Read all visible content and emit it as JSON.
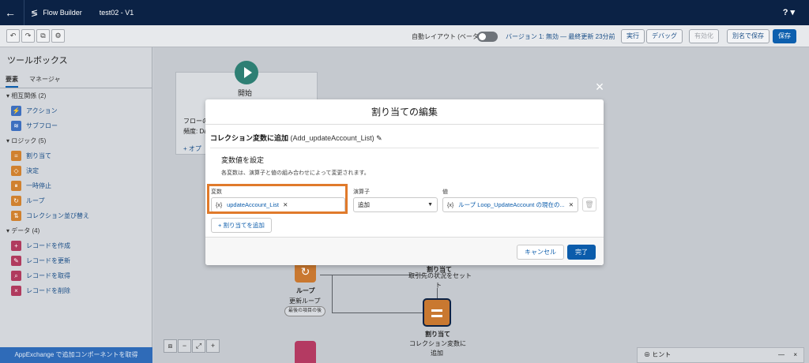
{
  "topbar": {
    "back_icon": "back-arrow-icon",
    "app_name": "Flow Builder",
    "flow_title": "test02 - V1",
    "help_label": "? ▾"
  },
  "toolbar": {
    "auto_layout_label": "自動レイアウト (ベータ)",
    "version_text": "バージョン 1: 無効 — 最終更新 23分前",
    "run_label": "実行",
    "debug_label": "デバッグ",
    "activate_label": "有効化",
    "save_as_label": "別名で保存",
    "save_label": "保存",
    "icons": [
      "↶",
      "↷",
      "⧉",
      "⚙"
    ]
  },
  "sidebar": {
    "title": "ツールボックス",
    "tabs": [
      "要素",
      "マネージャ"
    ],
    "sections": [
      {
        "label": "▾ 相互関係 (2)"
      },
      {
        "label": "▾ ロジック (5)"
      },
      {
        "label": "▾ データ (4)"
      }
    ],
    "items": [
      {
        "label": "アクション",
        "icon": "⚡",
        "color": "#3d6fbf"
      },
      {
        "label": "サブフロー",
        "icon": "≋",
        "color": "#3d6fbf"
      },
      {
        "label": "割り当て",
        "icon": "=",
        "color": "#d0812f"
      },
      {
        "label": "決定",
        "icon": "◇",
        "color": "#d0812f"
      },
      {
        "label": "一時停止",
        "icon": "⏸",
        "color": "#d0812f"
      },
      {
        "label": "ループ",
        "icon": "↻",
        "color": "#d0812f"
      },
      {
        "label": "コレクション並び替え",
        "icon": "⇅",
        "color": "#d0812f"
      },
      {
        "label": "レコードを作成",
        "icon": "+",
        "color": "#b03a5e"
      },
      {
        "label": "レコードを更新",
        "icon": "✎",
        "color": "#b03a5e"
      },
      {
        "label": "レコードを取得",
        "icon": "⌕",
        "color": "#b03a5e"
      },
      {
        "label": "レコードを削除",
        "icon": "×",
        "color": "#b03a5e"
      }
    ],
    "footer": "AppExchange で追加コンポーネントを取得"
  },
  "canvas": {
    "start_label": "開始",
    "card_text_1": "フローの",
    "card_text_2": "頻度: Da",
    "card_text_3": "+ オプ",
    "loop_label": "ループ",
    "loop_sub": "更新ループ",
    "loop_pill": "最後の項目の後",
    "assign_top_label": "割り当て",
    "assign_top_sub": "取引先の状況をセット",
    "assign_top_sub2": "ト",
    "assign_label": "割り当て",
    "assign_sub": "コレクション変数に",
    "assign_sub2": "追加",
    "zoom_controls": [
      "⧈",
      "−",
      "⤢",
      "+"
    ],
    "hint_label": "ヒント"
  },
  "modal": {
    "close_icon": "×",
    "title": "割り当ての編集",
    "element_type": "コレクション変数に追加",
    "api_name": "(Add_updateAccount_List)",
    "section_title": "変数値を設定",
    "section_desc": "各変数は、演算子と値の組み合わせによって変更されます。",
    "col_variable": "変数",
    "col_operator": "演算子",
    "col_value": "値",
    "variable_value": "updateAccount_List",
    "operator_value": "追加",
    "value_value": "ループ Loop_UpdateAccount の現在の...",
    "add_assignment": "+ 割り当てを追加",
    "cancel_label": "キャンセル",
    "done_label": "完了"
  }
}
